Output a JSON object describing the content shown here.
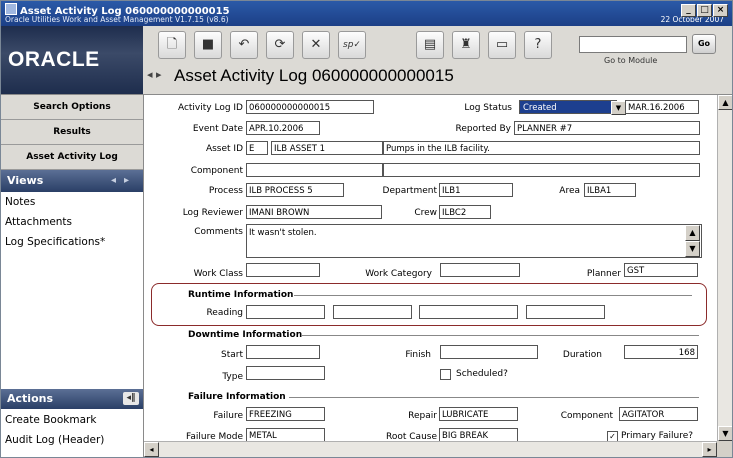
{
  "window": {
    "title": "Asset Activity Log 060000000000015",
    "subtitle": "Oracle Utilities Work and Asset Management V1.7.15 (v8.6)",
    "date": "22 October  2007"
  },
  "header": {
    "logo": "ORACLE",
    "page_title": "Asset Activity Log 060000000000015",
    "go_button": "Go",
    "go_to_module_label": "Go to Module"
  },
  "sidebar": {
    "tabs": [
      "Search Options",
      "Results",
      "Asset Activity Log"
    ],
    "views_label": "Views",
    "views": [
      "Notes",
      "Attachments",
      "Log Specifications*"
    ],
    "actions_label": "Actions",
    "actions": [
      "Create Bookmark",
      "Audit Log (Header)"
    ]
  },
  "form": {
    "activity_log_id_label": "Activity Log ID",
    "activity_log_id": "060000000000015",
    "log_status_label": "Log Status",
    "log_status": "Created",
    "log_status_date": "MAR.16.2006",
    "event_date_label": "Event Date",
    "event_date": "APR.10.2006",
    "reported_by_label": "Reported By",
    "reported_by": "PLANNER #7",
    "asset_id_label": "Asset ID",
    "asset_type": "E",
    "asset_id": "ILB ASSET 1",
    "asset_desc": "Pumps in the ILB facility.",
    "component_label": "Component",
    "component": "",
    "component_desc": "",
    "process_label": "Process",
    "process": "ILB PROCESS 5",
    "department_label": "Department",
    "department": "ILB1",
    "area_label": "Area",
    "area": "ILBA1",
    "log_reviewer_label": "Log Reviewer",
    "log_reviewer": "IMANI BROWN",
    "crew_label": "Crew",
    "crew": "ILBC2",
    "comments_label": "Comments",
    "comments": "It wasn't stolen.",
    "work_class_label": "Work Class",
    "work_class": "",
    "work_category_label": "Work Category",
    "work_category": "",
    "planner_label": "Planner",
    "planner": "GST"
  },
  "runtime": {
    "section_title": "Runtime Information",
    "reading_label": "Reading"
  },
  "downtime": {
    "section_title": "Downtime Information",
    "start_label": "Start",
    "start": "",
    "finish_label": "Finish",
    "finish": "",
    "duration_label": "Duration",
    "duration": "168",
    "type_label": "Type",
    "type": "",
    "scheduled_label": "Scheduled?"
  },
  "failure": {
    "section_title": "Failure Information",
    "failure_label": "Failure",
    "failure": "FREEZING",
    "repair_label": "Repair",
    "repair": "LUBRICATE",
    "component_label": "Component",
    "component": "AGITATOR",
    "failure_mode_label": "Failure Mode",
    "failure_mode": "METAL",
    "root_cause_label": "Root Cause",
    "root_cause": "BIG BREAK",
    "primary_failure_label": "Primary Failure?",
    "primary_failure_checked": true
  },
  "colors": {
    "highlight_border": "#8b2b2b",
    "status_selected": "#1d3f8f"
  },
  "icons": [
    "new-icon",
    "save-icon",
    "undo-icon",
    "refresh-icon",
    "delete-icon",
    "spell-check-icon",
    "print-icon",
    "attach-icon",
    "bookmark-icon",
    "help-icon"
  ]
}
